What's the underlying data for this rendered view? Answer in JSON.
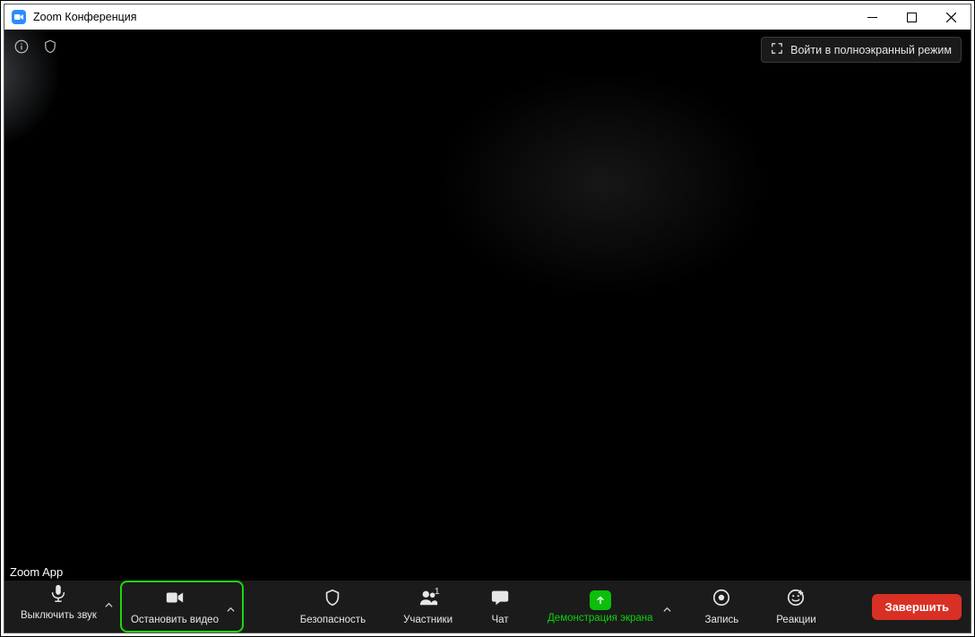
{
  "window": {
    "title": "Zoom Конференция"
  },
  "overlay": {
    "fullscreen_label": "Войти в полноэкранный режим",
    "app_label": "Zoom App"
  },
  "toolbar": {
    "mute_label": "Выключить звук",
    "video_label": "Остановить видео",
    "security_label": "Безопасность",
    "participants_label": "Участники",
    "participants_count": "1",
    "chat_label": "Чат",
    "share_label": "Демонстрация экрана",
    "record_label": "Запись",
    "reactions_label": "Реакции",
    "end_label": "Завершить"
  }
}
